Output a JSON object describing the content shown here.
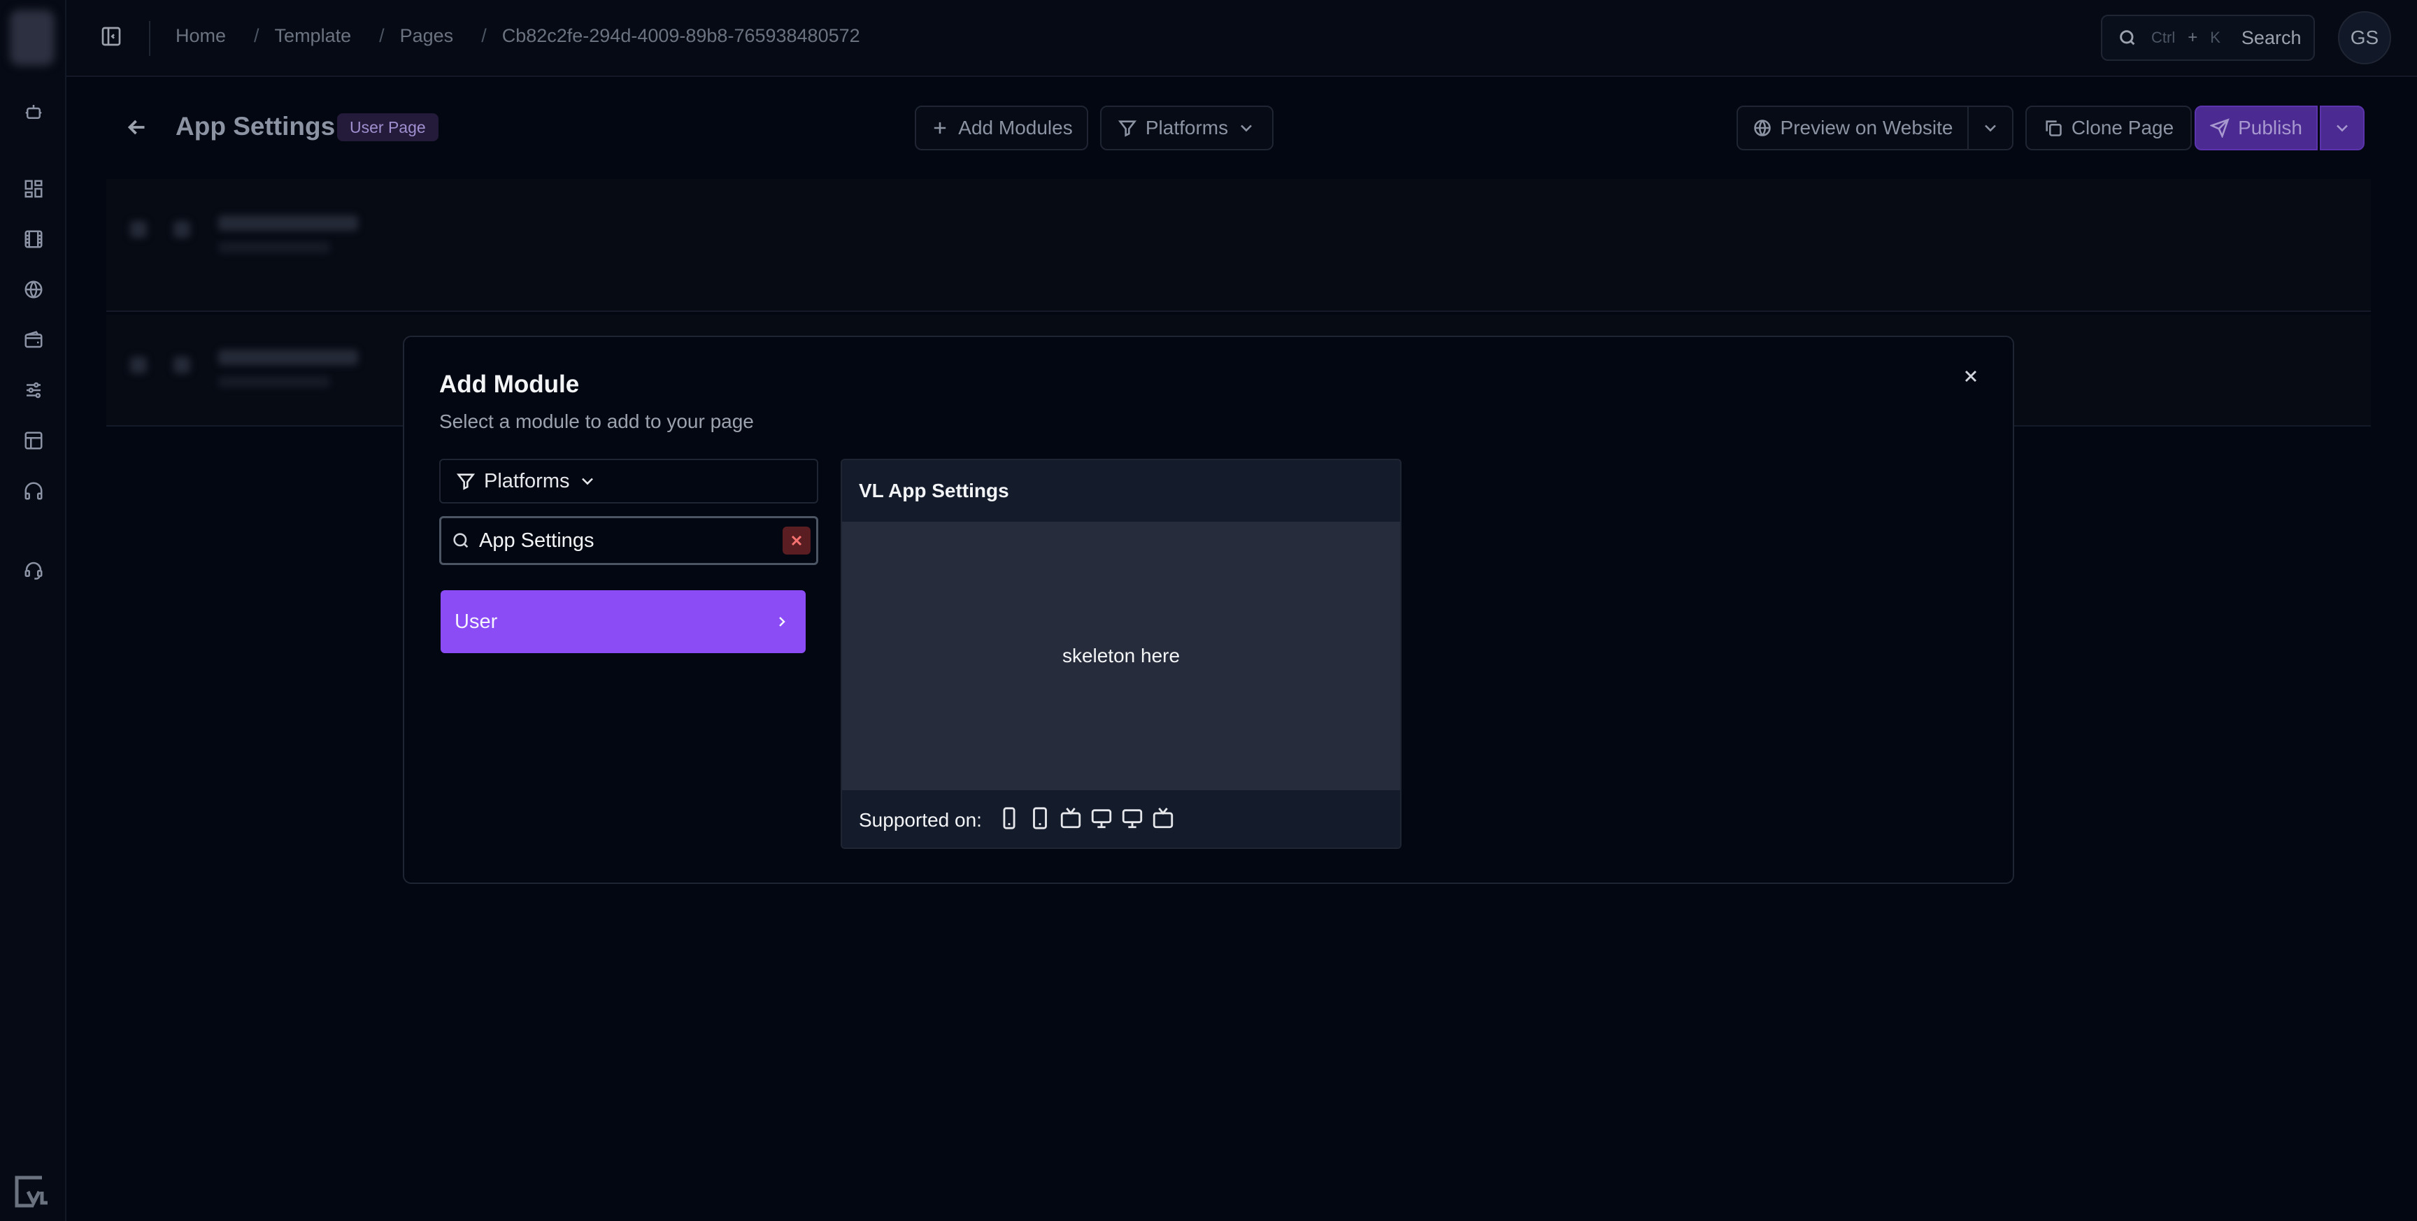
{
  "breadcrumb": {
    "items": [
      "Home",
      "Template",
      "Pages",
      "Cb82c2fe-294d-4009-89b8-765938480572"
    ]
  },
  "search": {
    "shortcut_mod": "Ctrl",
    "shortcut_plus": "+",
    "shortcut_key": "K",
    "label": "Search"
  },
  "user": {
    "initials": "GS"
  },
  "page_header": {
    "title": "App Settings",
    "badge": "User Page",
    "add_modules": "Add Modules",
    "platforms": "Platforms",
    "preview": "Preview on Website",
    "clone": "Clone Page",
    "publish": "Publish"
  },
  "modal": {
    "title": "Add Module",
    "subtitle": "Select a module to add to your page",
    "platforms_filter": "Platforms",
    "search_value": "App Settings",
    "result_category": "User",
    "preview": {
      "module_name": "VL App Settings",
      "body_text": "skeleton here",
      "supported_label": "Supported on:",
      "devices": [
        "mobile-icon",
        "tablet-icon",
        "tv-icon",
        "desktop-icon",
        "monitor-icon",
        "tv-icon"
      ]
    }
  },
  "colors": {
    "accent": "#8b4cf6",
    "publish_bg": "#4b2a91",
    "background": "#030712"
  }
}
